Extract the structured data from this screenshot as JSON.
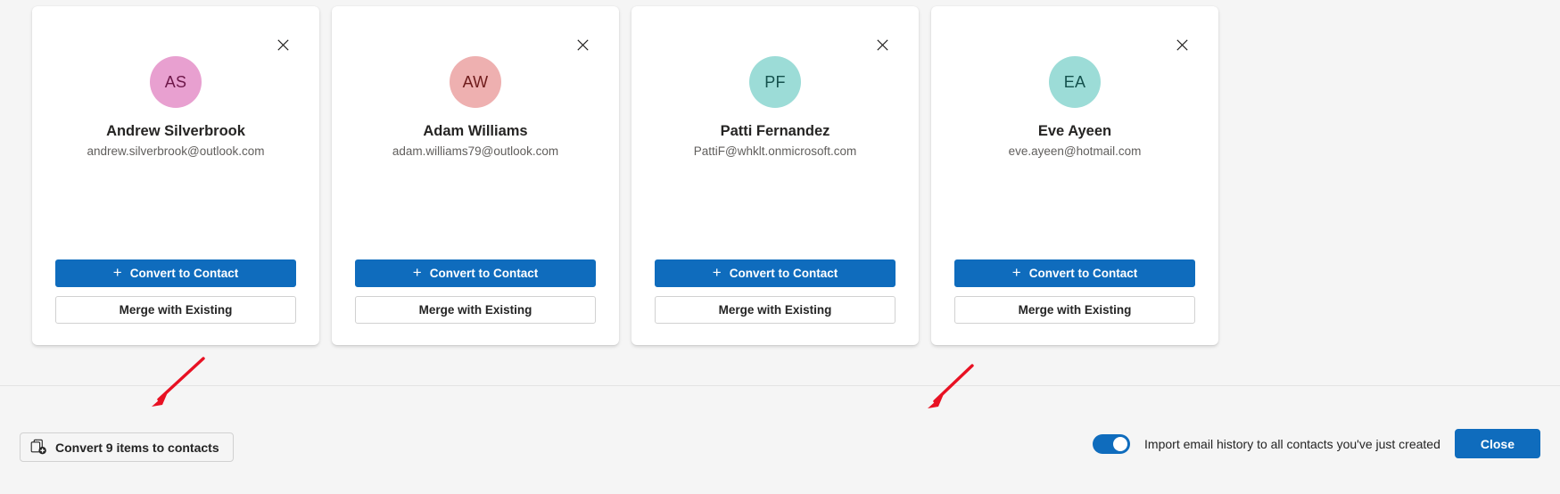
{
  "cards": [
    {
      "initials": "AS",
      "avatar_color": "#e8a0d0",
      "avatar_class": "pink",
      "name": "Andrew Silverbrook",
      "email": "andrew.silverbrook@outlook.com",
      "convert_label": "Convert to Contact",
      "merge_label": "Merge with Existing",
      "close_icon": "close-icon"
    },
    {
      "initials": "AW",
      "avatar_color": "#eeb0b0",
      "avatar_class": "salmon",
      "name": "Adam Williams",
      "email": "adam.williams79@outlook.com",
      "convert_label": "Convert to Contact",
      "merge_label": "Merge with Existing",
      "close_icon": "close-icon"
    },
    {
      "initials": "PF",
      "avatar_color": "#9cdcd7",
      "avatar_class": "teal",
      "name": "Patti Fernandez",
      "email": "PattiF@whklt.onmicrosoft.com",
      "convert_label": "Convert to Contact",
      "merge_label": "Merge with Existing",
      "close_icon": "close-icon"
    },
    {
      "initials": "EA",
      "avatar_color": "#9cdcd7",
      "avatar_class": "teal",
      "name": "Eve Ayeen",
      "email": "eve.ayeen@hotmail.com",
      "convert_label": "Convert to Contact",
      "merge_label": "Merge with Existing",
      "close_icon": "close-icon"
    }
  ],
  "footer": {
    "convert_all_label": "Convert 9 items to contacts",
    "convert_all_icon": "copy-add-icon",
    "toggle_label": "Import email history to all contacts you've just created",
    "toggle_state": "on",
    "close_label": "Close"
  },
  "colors": {
    "accent": "#0f6cbd",
    "page_background": "#f5f5f5",
    "card_background": "#ffffff",
    "border": "#d1d1d1",
    "annotation": "#e81123",
    "text_primary": "#242424",
    "text_secondary": "#605e5c"
  },
  "annotations": [
    {
      "name": "arrow-to-convert-all",
      "color": "#e81123"
    },
    {
      "name": "arrow-to-toggle",
      "color": "#e81123"
    }
  ]
}
